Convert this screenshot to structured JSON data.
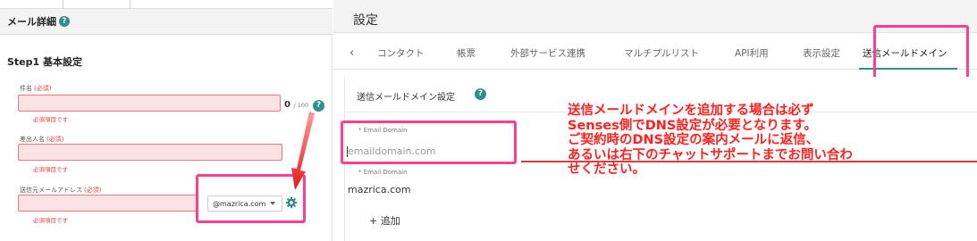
{
  "left_panel": {
    "title": "メール詳細",
    "help_glyph": "?",
    "step_title": "Step1 基本設定",
    "fields": {
      "subject": {
        "label": "件名",
        "required": "(必須)",
        "error": "必須項目です"
      },
      "sender_name": {
        "label": "差出人名",
        "required": "(必須)",
        "error": "必須項目です"
      },
      "sender_address": {
        "label": "送信元メールアドレス",
        "required": "(必須)",
        "error": "必須項目です"
      }
    },
    "counter": {
      "value": "0",
      "max": "/ 100"
    },
    "domain_select": {
      "value": "@mazrica.com"
    }
  },
  "right_panel": {
    "title": "設定",
    "back_glyph": "‹",
    "tabs": [
      "コンタクト",
      "帳票",
      "外部サービス連携",
      "マルチプルリスト",
      "API利用",
      "表示設定",
      "送信メールドメイン"
    ],
    "active_tab": "送信メールドメイン",
    "card": {
      "title": "送信メールドメイン設定",
      "help_glyph": "?",
      "fields": [
        {
          "label": "* Email Domain",
          "value": "emaildomain.com",
          "is_placeholder": true
        },
        {
          "label": "* Email Domain",
          "value": "mazrica.com",
          "is_placeholder": false
        }
      ],
      "add_button": "+ 追加"
    }
  },
  "annotation": {
    "text": "送信メールドメインを追加する場合は必ず\nSenses側でDNS設定が必要となります。\nご契約時のDNS設定の案内メールに返信、\nあるいは右下のチャットサポートまでお問い合わ\nせください。"
  },
  "colors": {
    "accent": "#2f8f88",
    "highlight_box": "#ff3f8e",
    "annotation_text": "#ff2020",
    "error": "#e04040",
    "error_fill": "#fbe3e3"
  }
}
